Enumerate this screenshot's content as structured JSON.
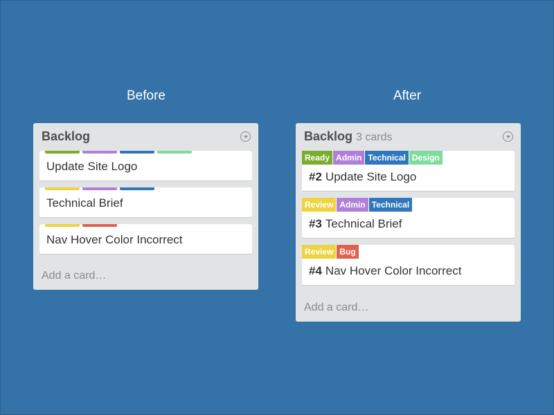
{
  "headings": {
    "before": "Before",
    "after": "After"
  },
  "colors": {
    "green": "#7bac2f",
    "purple": "#b07fd8",
    "blue": "#2f77bd",
    "mint": "#7fdc9e",
    "yellow": "#ecd440",
    "red": "#e0624e"
  },
  "before": {
    "list_title": "Backlog",
    "menu_icon": "chevron-down-circle-icon",
    "cards": [
      {
        "title": "Update Site Logo",
        "stripes": [
          "#7bac2f",
          "#b07fd8",
          "#2f77bd",
          "#7fdc9e"
        ]
      },
      {
        "title": "Technical Brief",
        "stripes": [
          "#ecd440",
          "#b07fd8",
          "#2f77bd"
        ]
      },
      {
        "title": "Nav Hover Color Incorrect",
        "stripes": [
          "#ecd440",
          "#e0624e"
        ]
      }
    ],
    "add_card": "Add a card…"
  },
  "after": {
    "list_title": "Backlog",
    "card_count": "3 cards",
    "menu_icon": "chevron-down-circle-icon",
    "cards": [
      {
        "number": "#2",
        "title": "Update Site Logo",
        "labels": [
          {
            "text": "Ready",
            "color": "#7bac2f"
          },
          {
            "text": "Admin",
            "color": "#b07fd8"
          },
          {
            "text": "Technical",
            "color": "#2f77bd"
          },
          {
            "text": "Design",
            "color": "#7fdc9e"
          }
        ]
      },
      {
        "number": "#3",
        "title": "Technical Brief",
        "labels": [
          {
            "text": "Review",
            "color": "#ecd440"
          },
          {
            "text": "Admin",
            "color": "#b07fd8"
          },
          {
            "text": "Technical",
            "color": "#2f77bd"
          }
        ]
      },
      {
        "number": "#4",
        "title": "Nav Hover Color Incorrect",
        "labels": [
          {
            "text": "Review",
            "color": "#ecd440"
          },
          {
            "text": "Bug",
            "color": "#e0624e"
          }
        ]
      }
    ],
    "add_card": "Add a card…"
  }
}
